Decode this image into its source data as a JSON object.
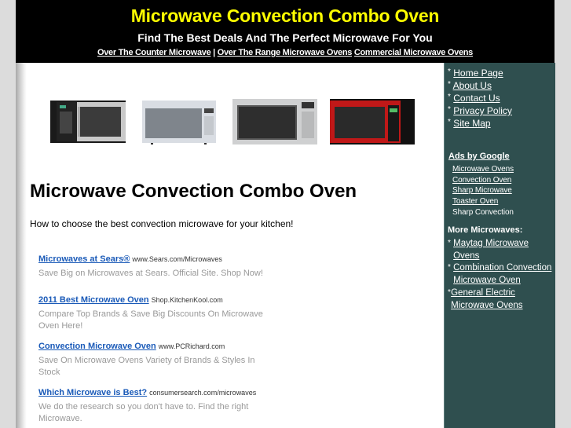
{
  "header": {
    "title": "Microwave Convection Combo Oven",
    "tagline": "Find The Best Deals And The Perfect Microwave For You",
    "nav": [
      {
        "label": "Over The Counter Microwave"
      },
      {
        "label": "Over The Range Microwave Ovens"
      },
      {
        "label": "Commercial Microwave Ovens"
      }
    ],
    "separator": "|"
  },
  "banner": {
    "images": [
      {
        "alt": "stainless steel microwave with black side"
      },
      {
        "alt": "white microwave"
      },
      {
        "alt": "silver Sharp microwave"
      },
      {
        "alt": "red and black microwave"
      }
    ]
  },
  "main": {
    "title": "Microwave Convection Combo Oven",
    "intro": "How to choose the best convection microwave for your kitchen!",
    "ads": [
      {
        "title": "Microwaves at Sears®",
        "url": "www.Sears.com/Microwaves",
        "desc": "Save Big on Microwaves at Sears. Official Site. Shop Now!"
      },
      {
        "title": "2011 Best Microwave Oven",
        "url": "Shop.KitchenKool.com",
        "desc": "Compare Top Brands & Save Big Discounts On Microwave Oven Here!"
      },
      {
        "title": "Convection Microwave Oven",
        "url": "www.PCRichard.com",
        "desc": "Save On Microwave Ovens Variety of Brands & Styles In Stock"
      },
      {
        "title": "Which Microwave is Best?",
        "url": "consumersearch.com/microwaves",
        "desc": "We do the research so you don't have to. Find the right Microwave."
      }
    ]
  },
  "sidebar": {
    "bullet": "*",
    "nav": [
      {
        "label": "Home Page"
      },
      {
        "label": "About Us"
      },
      {
        "label": "Contact Us"
      },
      {
        "label": "Privacy Policy"
      },
      {
        "label": "Site Map"
      }
    ],
    "ads_heading": "Ads by Google",
    "google_ads": [
      {
        "label": "Microwave Ovens"
      },
      {
        "label": "Convection Oven"
      },
      {
        "label": "Sharp Microwave"
      },
      {
        "label": "Toaster Oven"
      },
      {
        "label": "Sharp Convection"
      }
    ],
    "more_heading": "More Microwaves:",
    "more": [
      {
        "label": "Maytag Microwave Ovens"
      },
      {
        "label": "Combination Convection Microwave Oven"
      },
      {
        "label": "General Electric Microwave Ovens"
      }
    ]
  },
  "colors": {
    "title": "#ffff00",
    "header_bg": "#000000",
    "sidebar_bg": "#2f4f4f",
    "ad_link": "#1a5ab8",
    "page_bg": "#dcdcdc"
  }
}
